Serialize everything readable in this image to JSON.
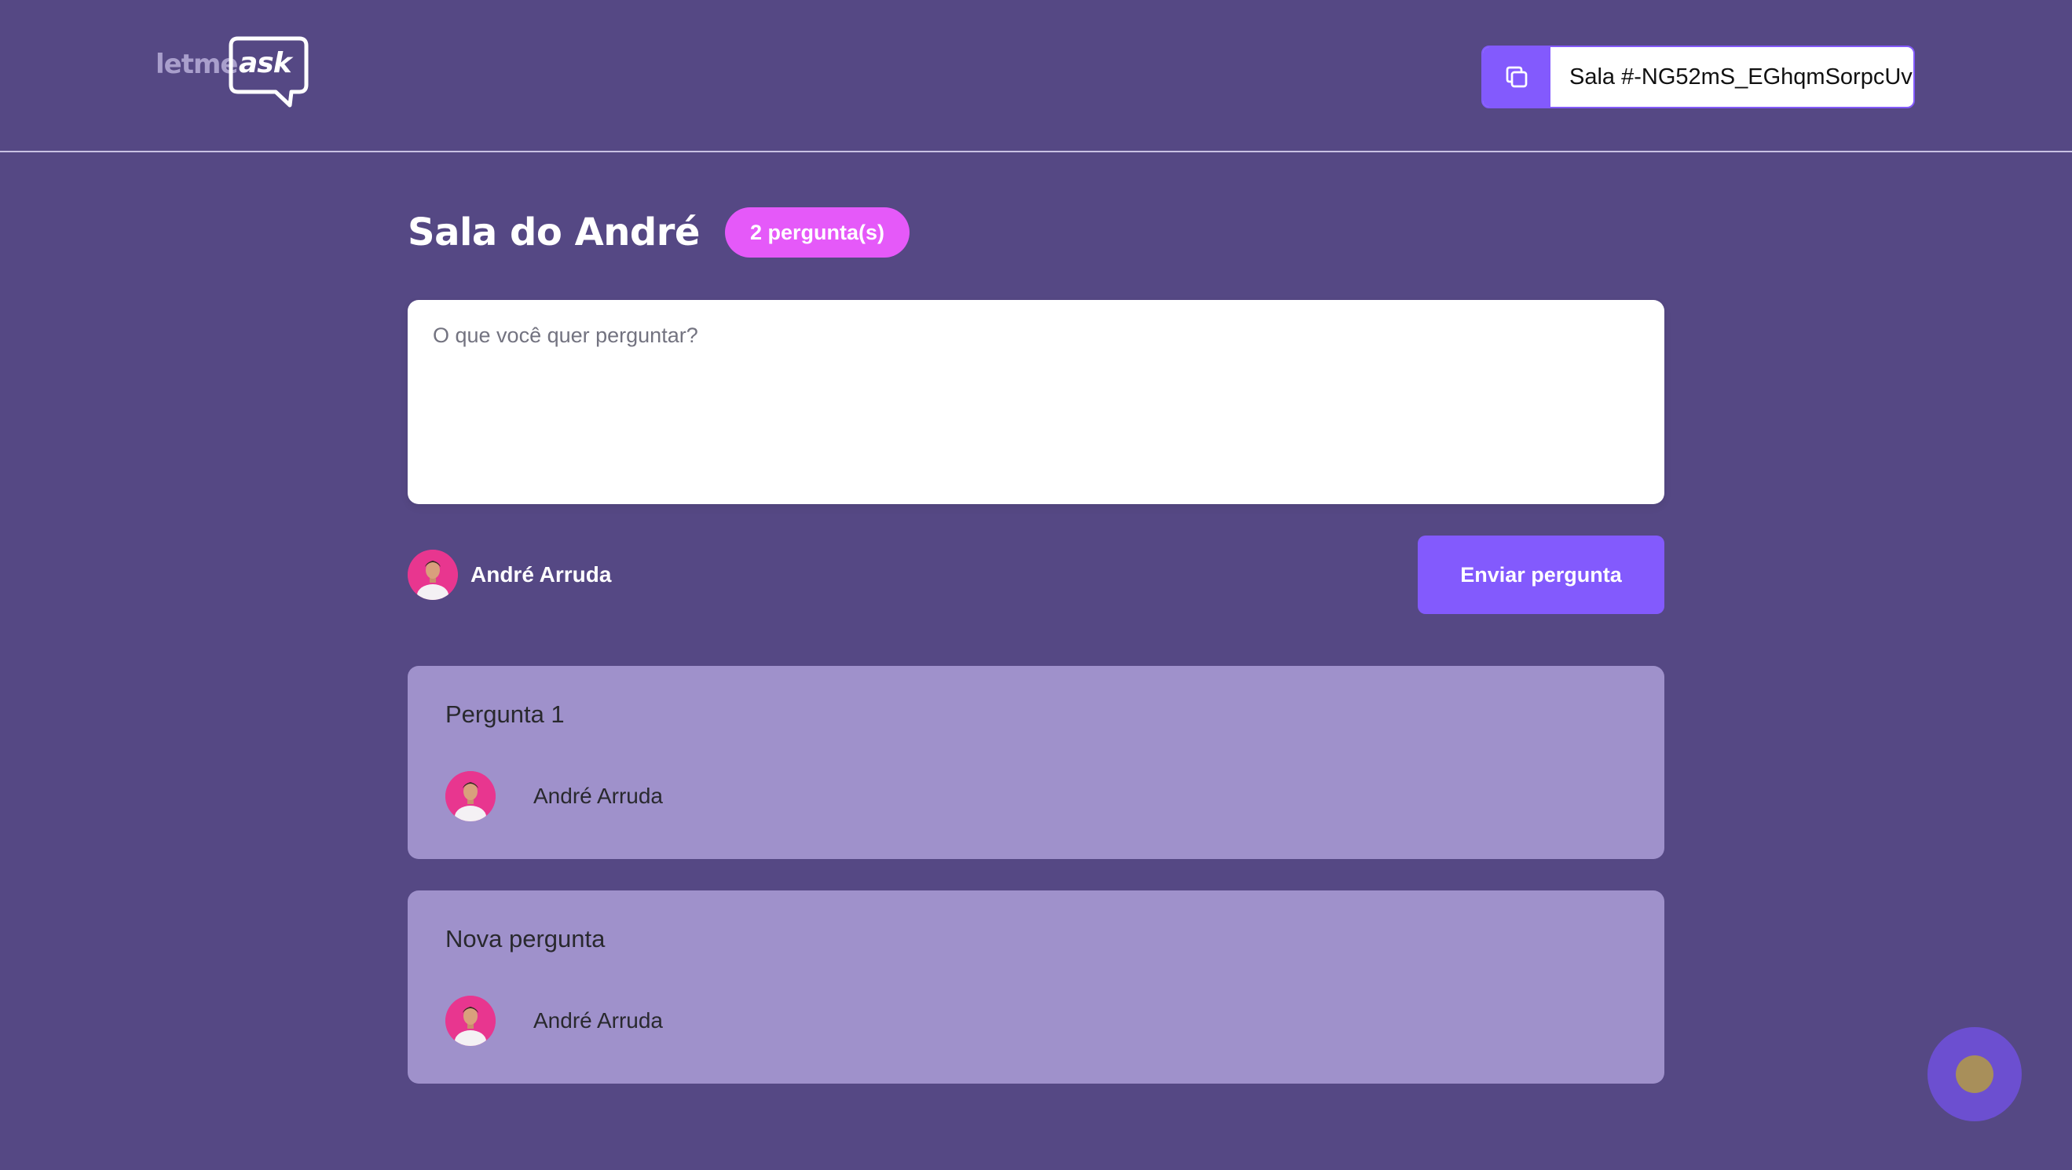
{
  "header": {
    "logo_text_left": "letme",
    "logo_text_right": "ask",
    "room_code_label": "Sala #-NG52mS_EGhqmSorpcUv",
    "copy_icon": "copy-icon"
  },
  "room": {
    "title": "Sala do André",
    "question_count": "2 pergunta(s)"
  },
  "form": {
    "placeholder": "O que você quer perguntar?",
    "user_name": "André Arruda",
    "submit_label": "Enviar pergunta"
  },
  "questions": [
    {
      "content": "Pergunta 1",
      "author": "André Arruda"
    },
    {
      "content": "Nova pergunta",
      "author": "André Arruda"
    }
  ],
  "colors": {
    "background": "#554884",
    "accent": "#835afd",
    "badge": "#e559f9",
    "card": "#9f91cb"
  }
}
